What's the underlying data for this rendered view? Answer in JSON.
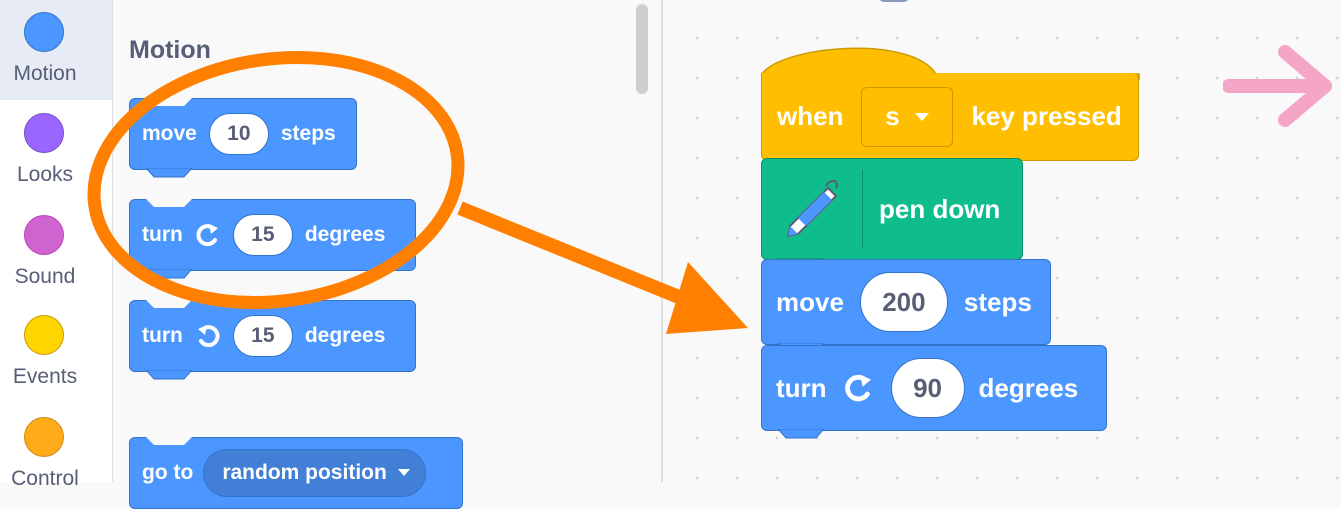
{
  "categories": [
    {
      "label": "Motion",
      "color": "#4c97ff",
      "border": "#3373cc"
    },
    {
      "label": "Looks",
      "color": "#9966ff",
      "border": "#774dcb"
    },
    {
      "label": "Sound",
      "color": "#cf63cf",
      "border": "#bd42bd"
    },
    {
      "label": "Events",
      "color": "#ffd500",
      "border": "#cc9900"
    },
    {
      "label": "Control",
      "color": "#ffab19",
      "border": "#cf8b17"
    }
  ],
  "palette": {
    "title": "Motion",
    "blocks": {
      "move": {
        "label": "move",
        "value": "10",
        "suffix": "steps"
      },
      "turn_right": {
        "label": "turn",
        "value": "15",
        "suffix": "degrees"
      },
      "turn_left": {
        "label": "turn",
        "value": "15",
        "suffix": "degrees"
      },
      "goto": {
        "label": "go to",
        "option": "random position"
      }
    }
  },
  "script": {
    "hat": {
      "label": "when",
      "key": "s",
      "suffix": "key pressed"
    },
    "pen": {
      "label": "pen down"
    },
    "move": {
      "label": "move",
      "value": "200",
      "suffix": "steps"
    },
    "turn": {
      "label": "turn",
      "value": "90",
      "suffix": "degrees"
    }
  },
  "colors": {
    "motion": "#4c97ff",
    "events": "#ffbf00",
    "pen": "#0fbd8c",
    "annotation": "#ff7f00",
    "arrow_pink": "#f5a5c5"
  }
}
